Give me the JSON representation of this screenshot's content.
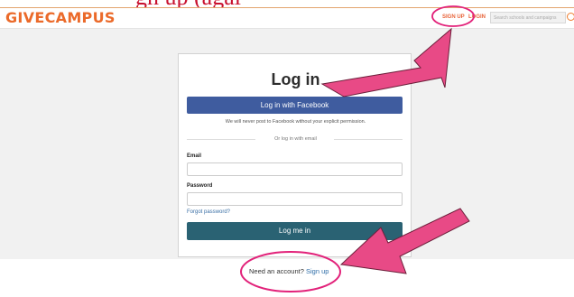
{
  "slide": {
    "heading": "gn up (agai"
  },
  "header": {
    "logo": "GIVECAMPUS",
    "sign_up": "SIGN UP",
    "log_in": "LOGIN",
    "search_placeholder": "Search schools and campaigns"
  },
  "login_card": {
    "title": "Log in",
    "facebook_button": "Log in with Facebook",
    "facebook_note": "We will never post to Facebook without your explicit permission.",
    "divider_text": "Or log in with email",
    "email_label": "Email",
    "email_value": "",
    "password_label": "Password",
    "password_value": "",
    "forgot_link": "Forgot password?",
    "submit_button": "Log me in"
  },
  "footer": {
    "prompt": "Need an account?",
    "sign_up_link": "Sign up"
  },
  "annotation": {
    "arrow_color": "#e84a86",
    "circle_color": "#e2227a"
  },
  "colors": {
    "brand_orange": "#eb6a2a",
    "facebook_blue": "#3f5c9f",
    "primary_teal": "#2a6273",
    "link_blue": "#2f6ea8"
  }
}
